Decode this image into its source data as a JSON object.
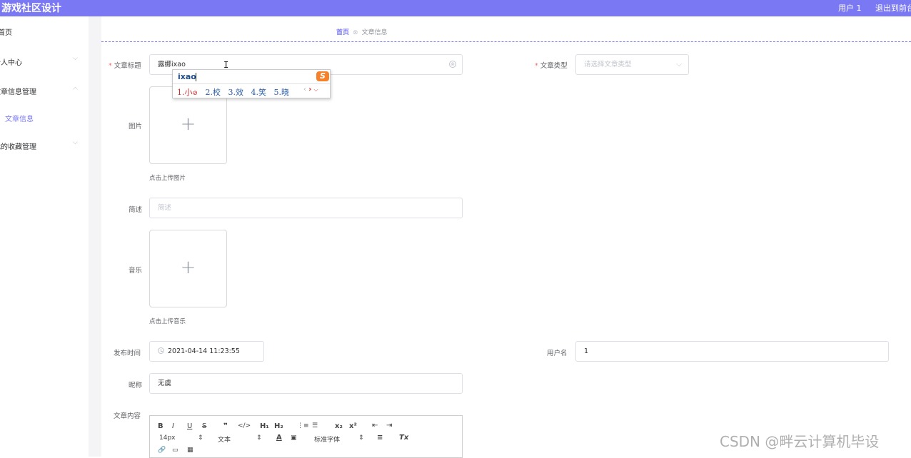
{
  "topbar": {
    "title": "游戏社区设计",
    "user": "用户 1",
    "logout": "退出到前台"
  },
  "sidebar": {
    "items": [
      {
        "label": "首页"
      },
      {
        "label": "个人中心",
        "arrow": "⌵"
      },
      {
        "label": "文章信息管理",
        "arrow": "⌵"
      },
      {
        "label": "文章信息"
      },
      {
        "label": "我的收藏管理",
        "arrow": "⌵"
      }
    ]
  },
  "breadcrumb": {
    "home": "首页",
    "separator": "⊗",
    "current": "文章信息"
  },
  "form": {
    "title": {
      "label": "文章标题",
      "value": "露娜ixao",
      "clear_icon": "⊗"
    },
    "type": {
      "label": "文章类型",
      "placeholder": "请选择文章类型",
      "arrow": "⌵"
    },
    "image": {
      "label": "图片",
      "plus": "+",
      "hint": "点击上传图片"
    },
    "summary": {
      "label": "简述",
      "placeholder": "简述"
    },
    "music": {
      "label": "音乐",
      "plus": "+",
      "hint": "点击上传音乐"
    },
    "publish_time": {
      "label": "发布时间",
      "value": "2021-04-14 11:23:55"
    },
    "username": {
      "label": "用户名",
      "value": "1"
    },
    "nickname": {
      "label": "昵称",
      "value": "无虞"
    },
    "content": {
      "label": "文章内容"
    }
  },
  "editor_toolbar": {
    "bold": "B",
    "italic": "I",
    "underline": "U",
    "strike": "S",
    "quote": "❞",
    "code": "</>",
    "h1": "H₁",
    "h2": "H₂",
    "ordered_list": "⋮≡",
    "bullet_list": "☰",
    "sub": "x₂",
    "sup": "x²",
    "outdent": "⇤",
    "indent": "⇥",
    "size": "14px",
    "size_arrow": "⇕",
    "block": "文本",
    "block_arrow": "⇕",
    "color": "A",
    "background": "▣",
    "font": "标准字体",
    "font_arrow": "⇕",
    "align": "≡",
    "clean": "Tx",
    "link": "🔗",
    "image": "▭",
    "video": "▦"
  },
  "ime": {
    "pinyin": "ixao",
    "logo": "S",
    "candidates": [
      "1.小",
      "2.校",
      "3.效",
      "4.笑",
      "5.晓"
    ],
    "first_mark": "⊘",
    "prev": "‹",
    "next": "›",
    "more": "⌵"
  },
  "cursor": "I",
  "watermark": "CSDN @畔云计算机毕设"
}
